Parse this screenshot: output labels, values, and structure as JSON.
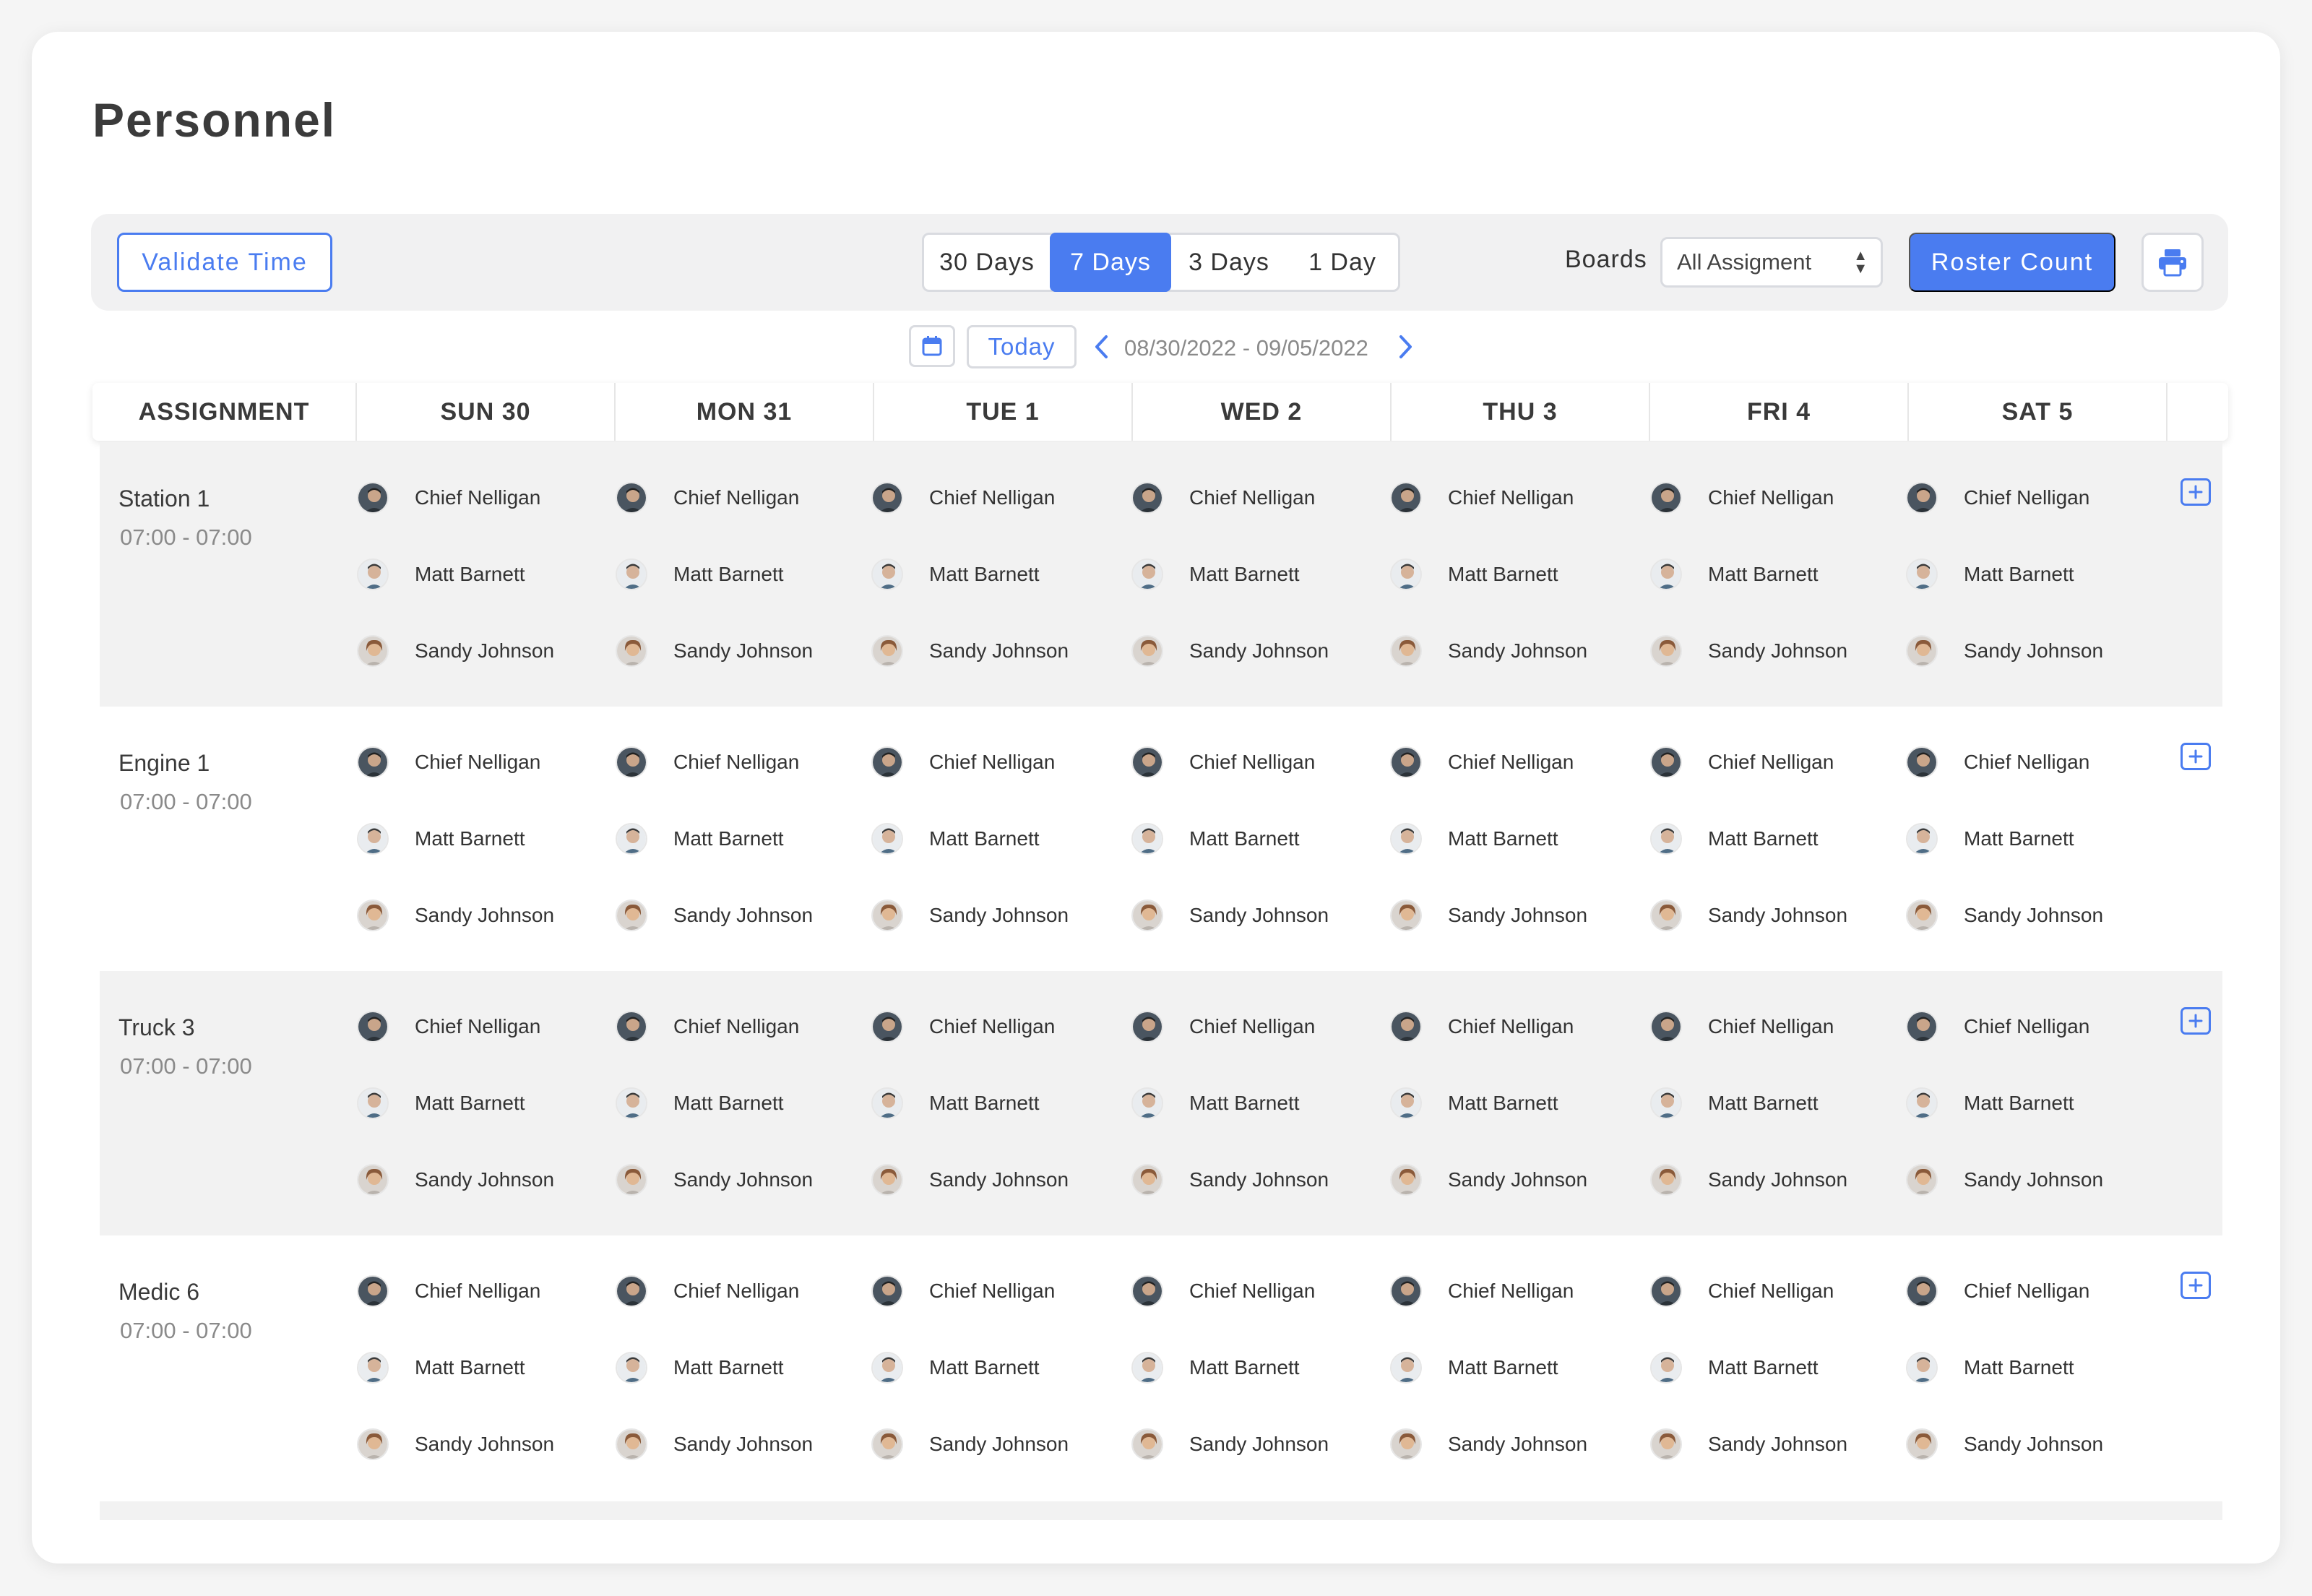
{
  "page": {
    "title": "Personnel"
  },
  "toolbar": {
    "validate_label": "Validate Time",
    "ranges": [
      "30 Days",
      "7 Days",
      "3 Days",
      "1 Day"
    ],
    "active_range": "7 Days",
    "boards_label": "Boards",
    "boards_value": "All Assigment",
    "roster_label": "Roster Count",
    "print_icon": "printer-icon"
  },
  "date_nav": {
    "today_label": "Today",
    "range": "08/30/2022 - 09/05/2022",
    "calendar_icon": "calendar-icon"
  },
  "table": {
    "headers": [
      "ASSIGNMENT",
      "SUN 30",
      "MON 31",
      "TUE 1",
      "WED 2",
      "THU 3",
      "FRI 4",
      "SAT 5"
    ],
    "rows": [
      {
        "name": "Station 1",
        "time": "07:00 - 07:00",
        "people": [
          "Chief Nelligan",
          "Matt Barnett",
          "Sandy Johnson"
        ]
      },
      {
        "name": "Engine 1",
        "time": "07:00 - 07:00",
        "people": [
          "Chief Nelligan",
          "Matt Barnett",
          "Sandy Johnson"
        ]
      },
      {
        "name": "Truck 3",
        "time": "07:00 - 07:00",
        "people": [
          "Chief Nelligan",
          "Matt Barnett",
          "Sandy Johnson"
        ]
      },
      {
        "name": "Medic 6",
        "time": "07:00 - 07:00",
        "people": [
          "Chief Nelligan",
          "Matt Barnett",
          "Sandy Johnson"
        ]
      }
    ]
  },
  "colors": {
    "accent": "#4a7cf0",
    "row_shade": "#f2f2f2",
    "muted_text": "#8a8a8a"
  }
}
